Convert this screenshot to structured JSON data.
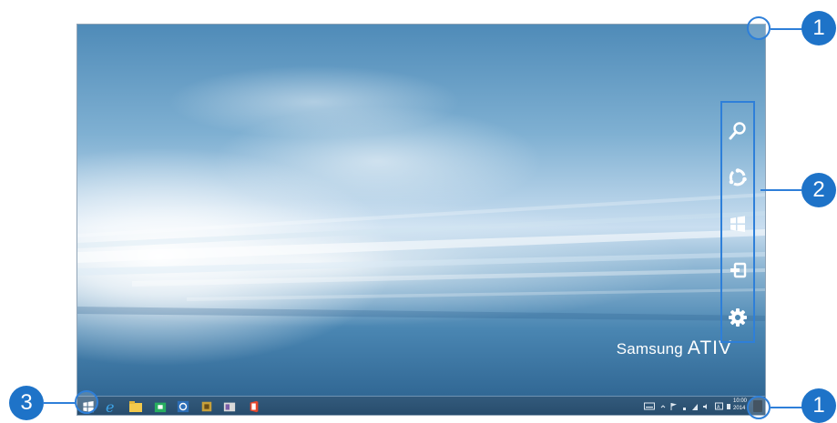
{
  "brand": {
    "name": "Samsung",
    "model": "ATIV"
  },
  "charms_bar": {
    "items": [
      {
        "name": "Search",
        "icon": "search-icon"
      },
      {
        "name": "Share",
        "icon": "share-icon"
      },
      {
        "name": "Start",
        "icon": "windows-logo-icon"
      },
      {
        "name": "Devices",
        "icon": "devices-icon"
      },
      {
        "name": "Settings",
        "icon": "gear-icon"
      }
    ]
  },
  "taskbar": {
    "start_button": "windows-start-icon",
    "pinned_apps": [
      "internet-explorer-icon",
      "file-explorer-icon",
      "store-icon",
      "app-icon",
      "app-icon",
      "app-icon",
      "office-icon"
    ],
    "tray_icons": [
      "keyboard-icon",
      "chevron-up-icon",
      "flag-icon",
      "network-icon",
      "signal-icon",
      "volume-icon",
      "language-icon",
      "notification-icon"
    ],
    "clock": {
      "time": "10:00",
      "date": "2014"
    }
  },
  "callouts": [
    "1",
    "2",
    "3",
    "1"
  ],
  "colors": {
    "accent": "#2e7fd9",
    "badge": "#1e73c8",
    "taskbar": "#2b5273"
  }
}
